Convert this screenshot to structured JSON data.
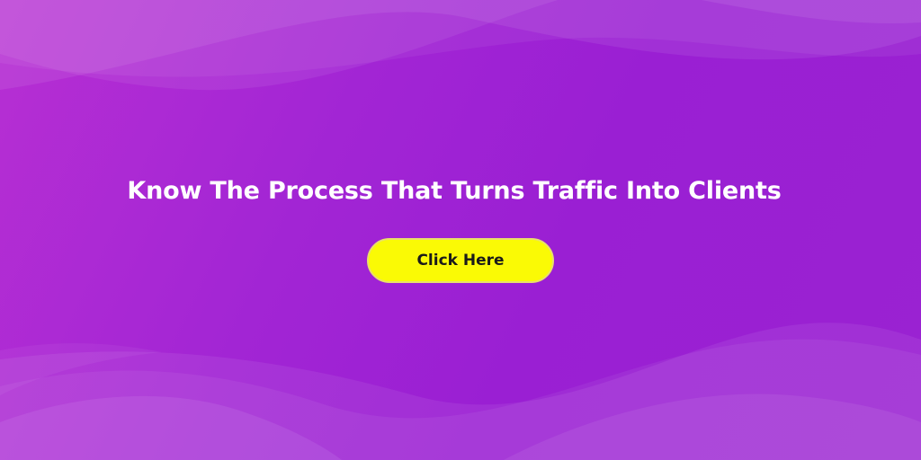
{
  "banner": {
    "headline": "Know The Process That Turns Traffic Into Clients",
    "cta_label": "Click Here"
  },
  "colors": {
    "background": "#9a1fd3",
    "background_light": "#b72fd3",
    "cta_background": "#fafa05",
    "headline_text": "#ffffff",
    "cta_text": "#1a1a1a"
  }
}
